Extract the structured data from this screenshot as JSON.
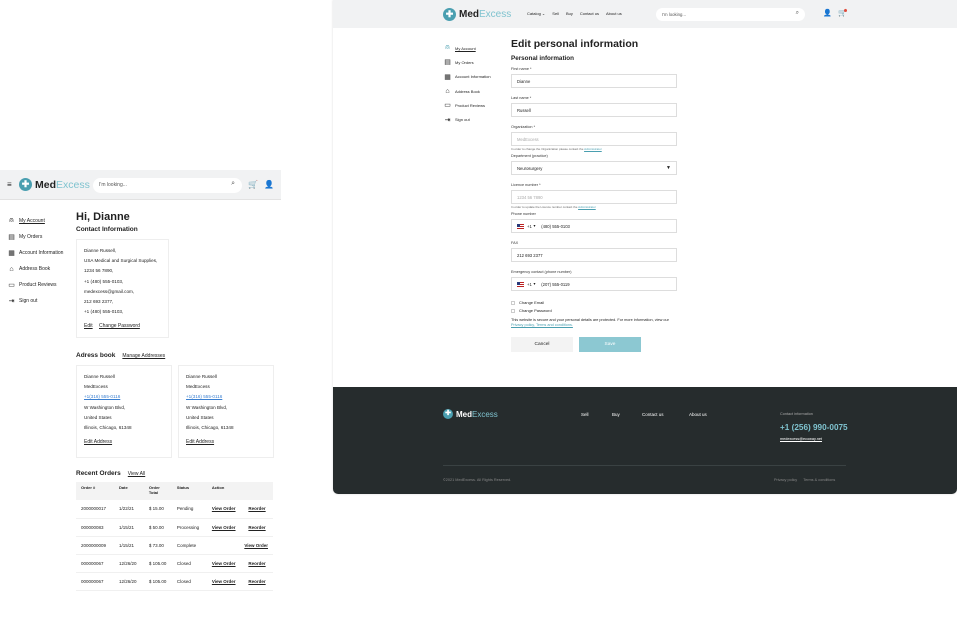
{
  "brand": {
    "name_a": "Med",
    "name_b": "Excess"
  },
  "mobile": {
    "search_placeholder": "I'm looking...",
    "sidebar": [
      "My Account",
      "My Orders",
      "Account Information",
      "Address Book",
      "Product Reviews",
      "Sign out"
    ],
    "greeting": "Hi, Dianne",
    "contact_heading": "Contact Information",
    "contact_lines": [
      "Dianne Russell,",
      "USA Medical and Surgical Supplies,",
      "1234 56 7890,",
      "+1 (480) 555-0103,",
      "medexcess@gmail.com,",
      "212 693 2377,",
      "+1 (480) 555-0103,"
    ],
    "edit_label": "Edit",
    "change_password_label": "Change Password",
    "address_heading": "Adress book",
    "manage_addresses_label": "Manage Addresses",
    "addresses": [
      {
        "lines": [
          "Dianne Russell",
          "MedExcess",
          "+1(316) 555-0116",
          "W Washington Blvd,",
          "United States",
          "Illinois, Chicago, 61348"
        ],
        "edit": "Edit Address"
      },
      {
        "lines": [
          "Dianne Russell",
          "MedExcess",
          "+1(316) 555-0116",
          "W Washington Blvd,",
          "United States",
          "Illinois, Chicago, 61348"
        ],
        "edit": "Edit Address"
      }
    ],
    "orders_heading": "Recent Orders",
    "view_all_label": "View All",
    "order_columns": [
      "Order #",
      "Date",
      "Order Total",
      "Status",
      "Action"
    ],
    "orders": [
      {
        "id": "2000000017",
        "date": "1/22/21",
        "total": "$ 15.00",
        "status": "Pending",
        "view": "View Order",
        "reorder": "Reorder"
      },
      {
        "id": "000000083",
        "date": "1/15/21",
        "total": "$ 50.00",
        "status": "Processing",
        "view": "View Order",
        "reorder": "Reorder"
      },
      {
        "id": "2000000009",
        "date": "1/15/21",
        "total": "$ 73.00",
        "status": "Complete",
        "view": "View Order",
        "reorder": ""
      },
      {
        "id": "000000067",
        "date": "12/26/20",
        "total": "$ 105.00",
        "status": "Closed",
        "view": "View Order",
        "reorder": "Reorder"
      },
      {
        "id": "000000067",
        "date": "12/26/20",
        "total": "$ 105.00",
        "status": "Closed",
        "view": "View Order",
        "reorder": "Reorder"
      }
    ]
  },
  "desktop": {
    "nav": [
      "Catalog",
      "Sell",
      "Buy",
      "Contact us",
      "About us"
    ],
    "search_placeholder": "I'm looking...",
    "sidebar": [
      "My Account",
      "My Orders",
      "Account Information",
      "Address Book",
      "Product Reviews",
      "Sign out"
    ],
    "title": "Edit personal information",
    "section": "Personal information",
    "fields": {
      "first_name": {
        "label": "First name *",
        "value": "Dianne"
      },
      "last_name": {
        "label": "Last name *",
        "value": "Russell"
      },
      "organization": {
        "label": "Organization *",
        "value": "MedExcess",
        "hint": "In order to change the Organization please contact the",
        "hint_link": "Administrator"
      },
      "department": {
        "label": "Department (practice)",
        "value": "Neurosurgery"
      },
      "licence": {
        "label": "Licence number *",
        "value": "1234 56 7890",
        "hint": "In order to update the Licence number contact the",
        "hint_link": "Administrator"
      },
      "phone": {
        "label": "Phone number",
        "code": "+1",
        "value": "(480) 555-0103"
      },
      "fax": {
        "label": "FAX",
        "value": "212 693 2377"
      },
      "emergency": {
        "label": "Emergency contact (phone number)",
        "code": "+1",
        "value": "(207) 555-0119"
      }
    },
    "change_email": "Change Email",
    "change_password": "Change Password",
    "privacy_text": "This website is secure and your personal details are protected. For more information, view our",
    "privacy_link": "Privacy policy, Terms and conditions.",
    "cancel_label": "Cancel",
    "save_label": "Save",
    "footer": {
      "nav": [
        "Sell",
        "Buy",
        "Contact us",
        "About us"
      ],
      "contact_title": "Contact information",
      "phone": "+1 (256) 990-0075",
      "email": "medexcess@ecoway.net",
      "copyright": "©2021 MedExcess. All Rights Reserved.",
      "links": [
        "Privacy policy",
        "Terms & conditions"
      ]
    }
  },
  "colors": {
    "accent": "#7fc3cf",
    "save": "#8cc8d2",
    "footer_bg": "#262c2d",
    "header_bg": "#f1f2f3"
  }
}
